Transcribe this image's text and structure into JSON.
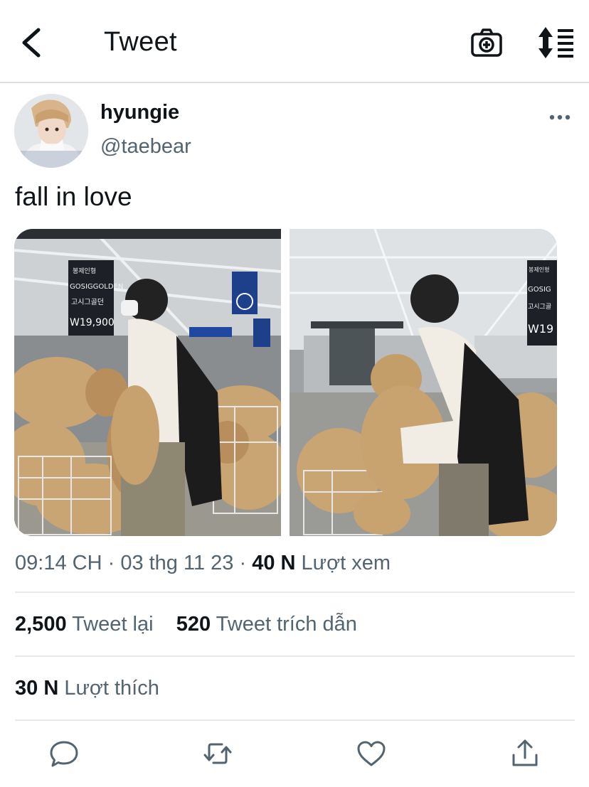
{
  "header": {
    "title": "Tweet",
    "back_icon": "chevron-left-icon",
    "camera_icon": "camera-plus-icon",
    "sort_icon": "sort-lines-icon"
  },
  "tweet": {
    "display_name": "hyungie",
    "handle": "@taebear",
    "text": "fall in love",
    "meta": {
      "time": "09:14 CH",
      "separator": "·",
      "date": "03 thg 11 23",
      "views_count": "40 N",
      "views_label": "Lượt xem"
    }
  },
  "stats": {
    "retweets_count": "2,500",
    "retweets_label": "Tweet lại",
    "quotes_count": "520",
    "quotes_label": "Tweet trích dẫn",
    "likes_count": "30 N",
    "likes_label": "Lượt thích"
  },
  "actions": [
    "reply-icon",
    "retweet-icon",
    "like-icon",
    "share-icon"
  ],
  "photos": [
    {
      "signs": [
        "봉제인형",
        "GOSIGGOLDEN",
        "고시그골던",
        "W19,900"
      ]
    },
    {
      "signs": [
        "봉제인형",
        "GOSIG",
        "고시그골",
        "W19"
      ]
    }
  ],
  "colors": {
    "text_primary": "#0f1419",
    "text_secondary": "#536471",
    "divider": "#e6e8ea"
  }
}
